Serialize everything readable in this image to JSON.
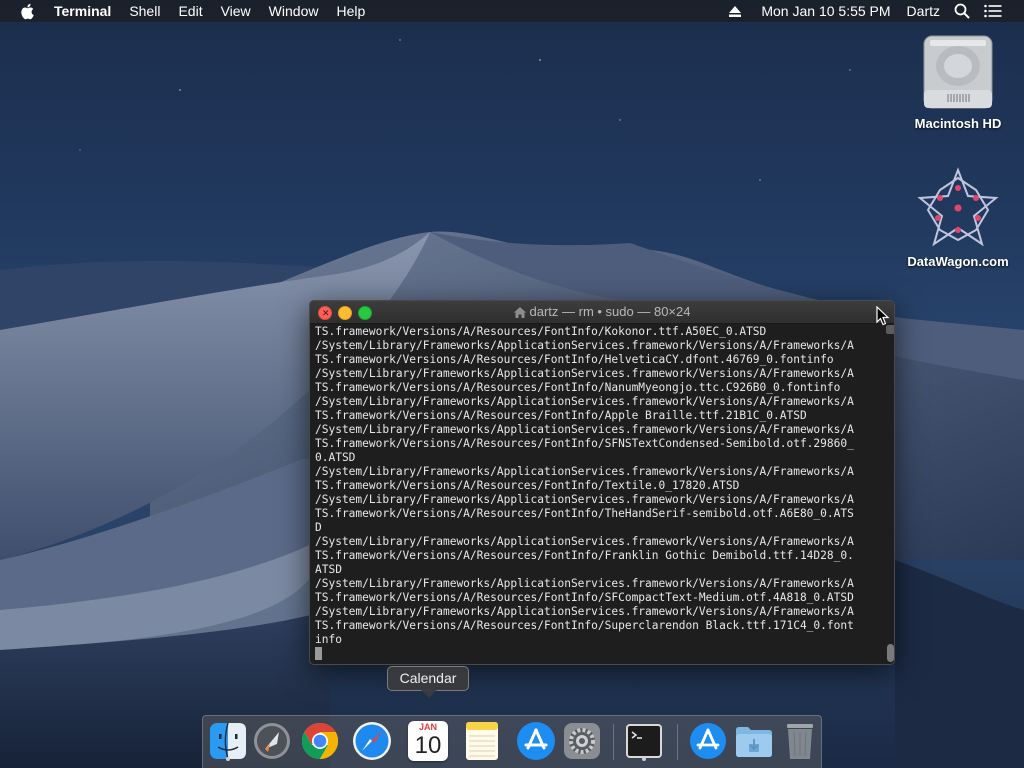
{
  "menubar": {
    "apple_icon": "apple-icon",
    "app_name": "Terminal",
    "items": [
      "Shell",
      "Edit",
      "View",
      "Window",
      "Help"
    ],
    "clock": "Mon Jan 10  5:55 PM",
    "user": "Dartz",
    "right_icons": [
      "eject-icon",
      "spotlight-icon",
      "notification-center-icon"
    ]
  },
  "desktop_icons": [
    {
      "label": "Macintosh HD",
      "icon": "hard-drive-icon"
    },
    {
      "label": "DataWagon.com",
      "icon": "datawagon-icon"
    }
  ],
  "terminal": {
    "title": "dartz — rm • sudo — 80×24",
    "lines": [
      "TS.framework/Versions/A/Resources/FontInfo/Kokonor.ttf.A50EC_0.ATSD",
      "/System/Library/Frameworks/ApplicationServices.framework/Versions/A/Frameworks/A",
      "TS.framework/Versions/A/Resources/FontInfo/HelveticaCY.dfont.46769_0.fontinfo",
      "/System/Library/Frameworks/ApplicationServices.framework/Versions/A/Frameworks/A",
      "TS.framework/Versions/A/Resources/FontInfo/NanumMyeongjo.ttc.C926B0_0.fontinfo",
      "/System/Library/Frameworks/ApplicationServices.framework/Versions/A/Frameworks/A",
      "TS.framework/Versions/A/Resources/FontInfo/Apple Braille.ttf.21B1C_0.ATSD",
      "/System/Library/Frameworks/ApplicationServices.framework/Versions/A/Frameworks/A",
      "TS.framework/Versions/A/Resources/FontInfo/SFNSTextCondensed-Semibold.otf.29860_",
      "0.ATSD",
      "/System/Library/Frameworks/ApplicationServices.framework/Versions/A/Frameworks/A",
      "TS.framework/Versions/A/Resources/FontInfo/Textile.0_17820.ATSD",
      "/System/Library/Frameworks/ApplicationServices.framework/Versions/A/Frameworks/A",
      "TS.framework/Versions/A/Resources/FontInfo/TheHandSerif-semibold.otf.A6E80_0.ATS",
      "D",
      "/System/Library/Frameworks/ApplicationServices.framework/Versions/A/Frameworks/A",
      "TS.framework/Versions/A/Resources/FontInfo/Franklin Gothic Demibold.ttf.14D28_0.",
      "ATSD",
      "/System/Library/Frameworks/ApplicationServices.framework/Versions/A/Frameworks/A",
      "TS.framework/Versions/A/Resources/FontInfo/SFCompactText-Medium.otf.4A818_0.ATSD",
      "/System/Library/Frameworks/ApplicationServices.framework/Versions/A/Frameworks/A",
      "TS.framework/Versions/A/Resources/FontInfo/Superclarendon Black.ttf.171C4_0.font",
      "info"
    ]
  },
  "tooltip": "Calendar",
  "dock": {
    "items": [
      {
        "name": "finder-icon",
        "running": true
      },
      {
        "name": "launchpad-icon",
        "running": false
      },
      {
        "name": "chrome-icon",
        "running": false
      },
      {
        "name": "safari-icon",
        "running": false
      },
      {
        "name": "calendar-icon",
        "running": false,
        "month": "JAN",
        "day": "10"
      },
      {
        "name": "notes-icon",
        "running": false
      },
      {
        "name": "app-store-icon",
        "running": false
      },
      {
        "name": "system-preferences-icon",
        "running": false
      },
      {
        "name": "terminal-icon",
        "running": true
      },
      {
        "name": "downloads-stack-icon",
        "running": false
      },
      {
        "name": "folder-icon",
        "running": false
      },
      {
        "name": "trash-icon",
        "running": false
      }
    ]
  },
  "colors": {
    "close": "#fc5f57",
    "minimize": "#fdbc2e",
    "maximize": "#28c840",
    "terminal_bg": "#1e1e1e",
    "terminal_text": "#e8e8e8"
  }
}
